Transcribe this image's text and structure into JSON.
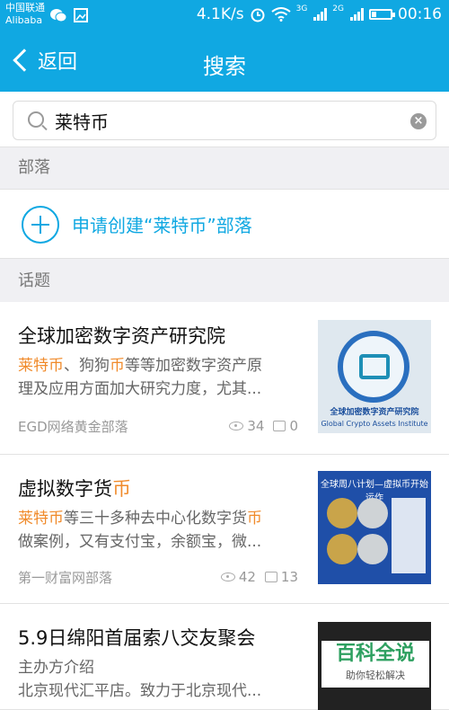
{
  "status_bar": {
    "carrier_line1": "中国联通",
    "carrier_line2": "Alibaba",
    "speed": "4.1K/s",
    "network_3g": "3G",
    "network_2g": "2G",
    "time": "00:16",
    "battery_level": 0.25
  },
  "nav": {
    "back_label": "返回",
    "title": "搜索"
  },
  "search": {
    "value": "莱特币"
  },
  "sections": {
    "tribe_label": "部落",
    "topic_label": "话题"
  },
  "create_tribe": {
    "label": "申请创建“莱特币”部落"
  },
  "topics": [
    {
      "title_plain": "全球加密数字资产研究院",
      "desc_line1": [
        "莱特币",
        "、狗狗",
        "币",
        "等等加密数字资产原"
      ],
      "desc_line2": "理及应用方面加大研究力度，尤其...",
      "source": "EGD网络黄金部落",
      "views": "34",
      "comments": "0",
      "thumb_caption": "全球加密数字资产研究院",
      "thumb_caption_en": "Global Crypto Assets Institute"
    },
    {
      "title_plain": "虚拟数字货",
      "title_hl": "币",
      "desc_line1": [
        "莱特币",
        "等三十多种去中心化数字货",
        "币"
      ],
      "desc_line2": "做案例，又有支付宝，余额宝，微...",
      "source": "第一财富网部落",
      "views": "42",
      "comments": "13",
      "thumb_head": "全球周八计划—虚拟币开始运作"
    },
    {
      "title_plain": "5.9日绵阳首届索八交友聚会",
      "desc_line1_plain": "主办方介绍",
      "desc_line2": "北京现代汇平店。致力于北京现代..."
    }
  ],
  "watermark": {
    "title": "百科全说",
    "subtitle": "助你轻松解决"
  },
  "colors": {
    "accent": "#10a8e2",
    "highlight": "#f08a2a"
  }
}
